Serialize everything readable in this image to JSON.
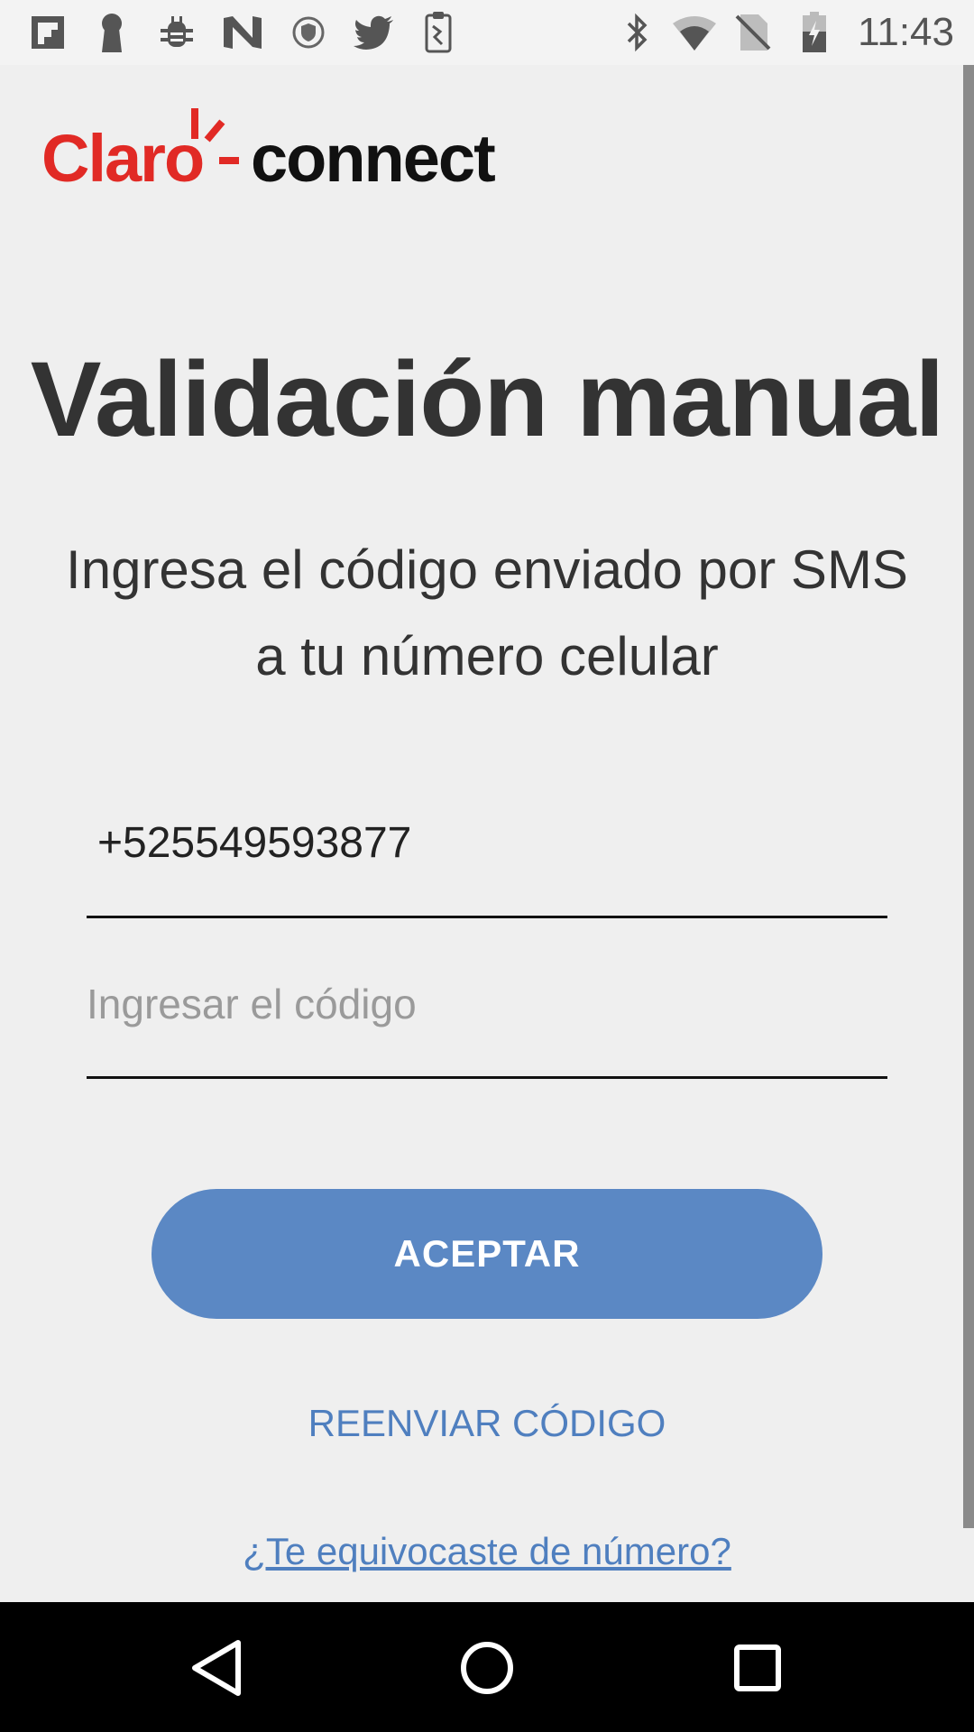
{
  "status_bar": {
    "time": "11:43",
    "left_icons": [
      "flipboard-icon",
      "keyhole-icon",
      "bug-icon",
      "n-app-icon",
      "shield-icon",
      "twitter-icon",
      "clipboard-icon"
    ],
    "right_icons": [
      "bluetooth-icon",
      "wifi-icon",
      "no-sim-icon",
      "battery-charging-icon"
    ]
  },
  "logo": {
    "brand_red": "Claro",
    "brand_dark": "connect",
    "brand_color": "#e12a25"
  },
  "main": {
    "title": "Validación manual",
    "subtitle": "Ingresa el código enviado por SMS a tu número celular",
    "phone_number": "+525549593877",
    "code_value": "",
    "code_placeholder": "Ingresar el código",
    "accept_label": "ACEPTAR",
    "resend_label": "REENVIAR CÓDIGO",
    "wrong_number_label": "¿Te equivocaste de número?"
  },
  "colors": {
    "accent": "#5b88c4",
    "link": "#4f7fbf",
    "background": "#efefef"
  },
  "nav_bar": {
    "buttons": [
      "back-icon",
      "home-icon",
      "recents-icon"
    ]
  }
}
